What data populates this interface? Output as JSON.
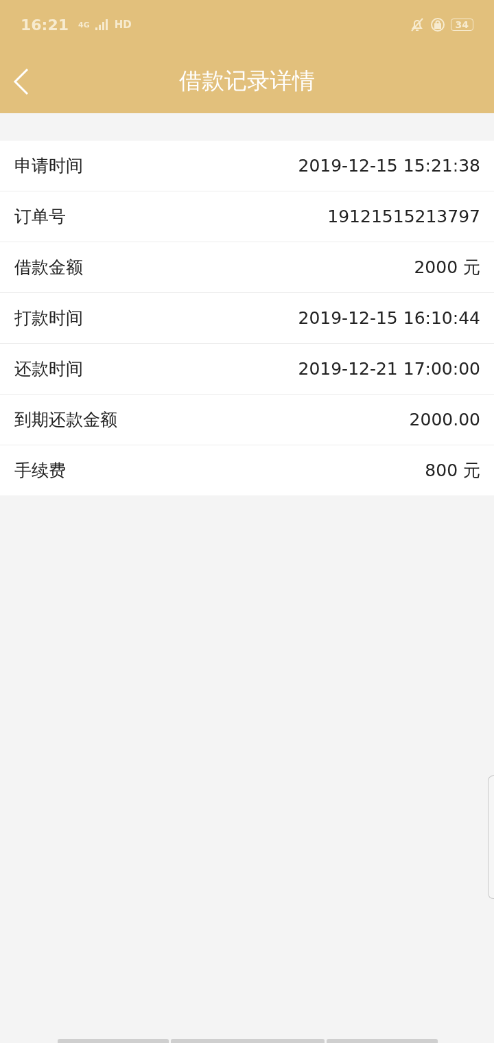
{
  "status_bar": {
    "time": "16:21",
    "network": "4G",
    "call": "HD",
    "battery": "34"
  },
  "header": {
    "title": "借款记录详情"
  },
  "rows": [
    {
      "label": "申请时间",
      "value": "2019-12-15 15:21:38"
    },
    {
      "label": "订单号",
      "value": "19121515213797"
    },
    {
      "label": "借款金额",
      "value": "2000 元"
    },
    {
      "label": "打款时间",
      "value": "2019-12-15 16:10:44"
    },
    {
      "label": "还款时间",
      "value": "2019-12-21 17:00:00"
    },
    {
      "label": "到期还款金额",
      "value": "2000.00"
    },
    {
      "label": "手续费",
      "value": "800 元"
    }
  ]
}
